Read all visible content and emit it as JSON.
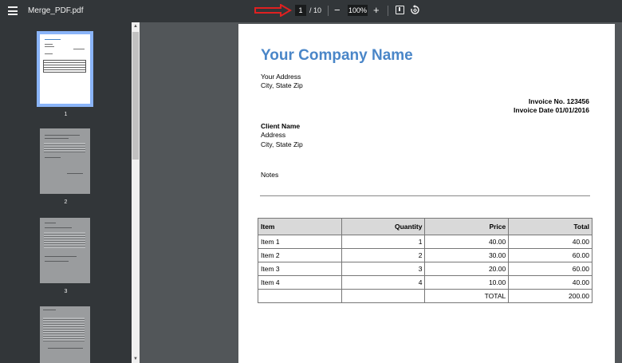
{
  "toolbar": {
    "file_name": "Merge_PDF.pdf",
    "current_page": "1",
    "total_pages": "/ 10",
    "zoom": "100%",
    "zoom_out": "−",
    "zoom_in": "+"
  },
  "sidebar": {
    "thumbnails": [
      {
        "label": "1"
      },
      {
        "label": "2"
      },
      {
        "label": "3"
      }
    ]
  },
  "invoice": {
    "company_name": "Your Company Name",
    "address_line1": "Your Address",
    "address_line2": "City, State Zip",
    "invoice_no": "Invoice No. 123456",
    "invoice_date": "Invoice Date 01/01/2016",
    "client_label": "Client Name",
    "client_address": "Address",
    "client_city": "City, State Zip",
    "notes_label": "Notes",
    "table": {
      "headers": [
        "Item",
        "Quantity",
        "Price",
        "Total"
      ],
      "rows": [
        [
          "Item 1",
          "1",
          "40.00",
          "40.00"
        ],
        [
          "Item 2",
          "2",
          "30.00",
          "60.00"
        ],
        [
          "Item 3",
          "3",
          "20.00",
          "60.00"
        ],
        [
          "Item 4",
          "4",
          "10.00",
          "40.00"
        ]
      ],
      "total_label": "TOTAL",
      "total_value": "200.00"
    }
  },
  "colors": {
    "toolbar_bg": "#323639",
    "viewer_bg": "#525659",
    "company_blue": "#4a86c8",
    "selected_thumb_border": "#8ab4f8",
    "annotation_arrow": "#e02020"
  },
  "icons": [
    "menu-icon",
    "arrow-annotation-icon",
    "fit-page-icon",
    "rotate-icon"
  ]
}
